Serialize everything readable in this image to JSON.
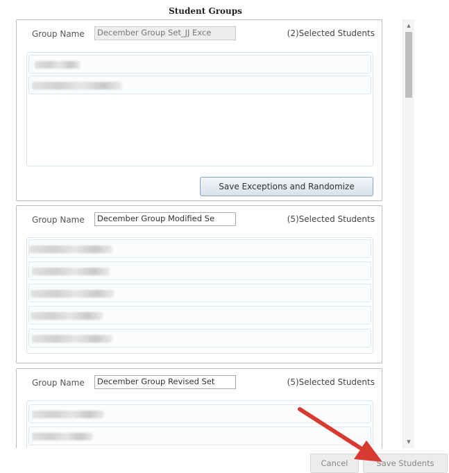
{
  "dialog": {
    "title": "Student Groups"
  },
  "groups": [
    {
      "label": "Group Name",
      "name_value": "December Group Set_JJ Exce",
      "selected_text": "(2)Selected Students",
      "student_count_rows": 2,
      "save_button": "Save Exceptions and Randomize"
    },
    {
      "label": "Group Name",
      "name_value": "December Group Modified Se",
      "selected_text": "(5)Selected Students"
    },
    {
      "label": "Group Name",
      "name_value": "December Group Revised Set",
      "selected_text": "(5)Selected Students"
    }
  ],
  "footer": {
    "cancel_label": "Cancel",
    "save_label": "Save Students"
  },
  "colors": {
    "annotation_arrow": "#d93a2f",
    "button_gradient_top": "#f3f6fa",
    "button_gradient_bottom": "#d8e1ec",
    "panel_border": "#b9b9b9"
  },
  "icons": {
    "scroll_up": "scroll-up-arrow-icon",
    "scroll_down": "scroll-down-arrow-icon",
    "annotation": "red-arrow-annotation-icon"
  }
}
